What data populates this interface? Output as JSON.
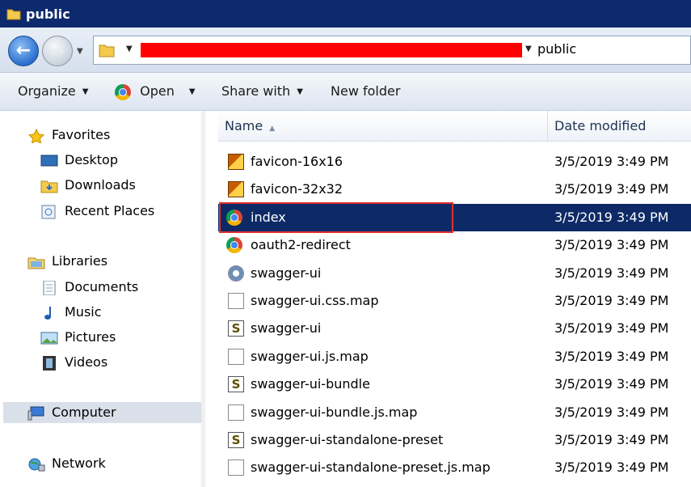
{
  "window": {
    "title": "public"
  },
  "address": {
    "current_folder": "public"
  },
  "toolbar": {
    "organize": "Organize",
    "open": "Open",
    "share_with": "Share with",
    "new_folder": "New folder"
  },
  "nav": {
    "favorites": "Favorites",
    "desktop": "Desktop",
    "downloads": "Downloads",
    "recent_places": "Recent Places",
    "libraries": "Libraries",
    "documents": "Documents",
    "music": "Music",
    "pictures": "Pictures",
    "videos": "Videos",
    "computer": "Computer",
    "network": "Network"
  },
  "columns": {
    "name": "Name",
    "date_modified": "Date modified"
  },
  "files": [
    {
      "name": "favicon-16x16",
      "date": "3/5/2019 3:49 PM",
      "icon": "image-icon"
    },
    {
      "name": "favicon-32x32",
      "date": "3/5/2019 3:49 PM",
      "icon": "image-icon"
    },
    {
      "name": "index",
      "date": "3/5/2019 3:49 PM",
      "icon": "chrome-icon"
    },
    {
      "name": "oauth2-redirect",
      "date": "3/5/2019 3:49 PM",
      "icon": "chrome-icon"
    },
    {
      "name": "swagger-ui",
      "date": "3/5/2019 3:49 PM",
      "icon": "css-file-icon"
    },
    {
      "name": "swagger-ui.css.map",
      "date": "3/5/2019 3:49 PM",
      "icon": "document-icon"
    },
    {
      "name": "swagger-ui",
      "date": "3/5/2019 3:49 PM",
      "icon": "script-icon"
    },
    {
      "name": "swagger-ui.js.map",
      "date": "3/5/2019 3:49 PM",
      "icon": "document-icon"
    },
    {
      "name": "swagger-ui-bundle",
      "date": "3/5/2019 3:49 PM",
      "icon": "script-icon"
    },
    {
      "name": "swagger-ui-bundle.js.map",
      "date": "3/5/2019 3:49 PM",
      "icon": "document-icon"
    },
    {
      "name": "swagger-ui-standalone-preset",
      "date": "3/5/2019 3:49 PM",
      "icon": "script-icon"
    },
    {
      "name": "swagger-ui-standalone-preset.js.map",
      "date": "3/5/2019 3:49 PM",
      "icon": "document-icon"
    }
  ],
  "selection": {
    "selected_file": "index"
  },
  "colors": {
    "title_bar": "#0e2a6e",
    "selection": "#0d2a66",
    "highlight_box": "#e03030",
    "redaction": "#ff0000"
  }
}
